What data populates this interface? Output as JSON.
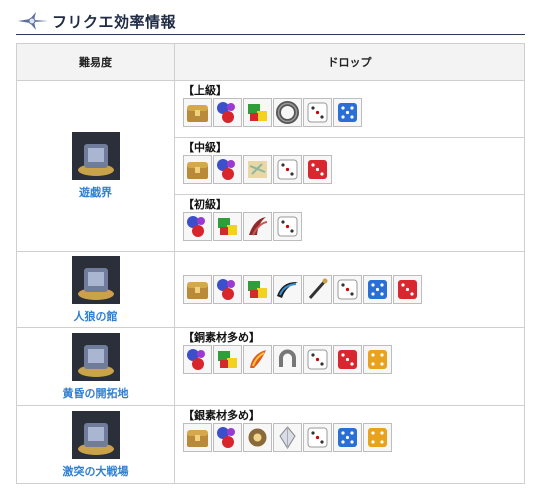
{
  "header": {
    "title": "フリクエ効率情報"
  },
  "table": {
    "col_area": "難易度",
    "col_drop": "ドロップ",
    "rows": [
      {
        "area": "遊戯界",
        "tiers": [
          {
            "label": "【上級】",
            "items": [
              "treasure-chest-icon",
              "gem-cluster-icon",
              "green-block-icon",
              "iron-ring-icon",
              "white-die-icon",
              "blue-die-icon"
            ]
          },
          {
            "label": "【中級】",
            "items": [
              "treasure-chest-icon",
              "gem-cluster-icon",
              "map-scroll-icon",
              "white-die-icon",
              "red-die-icon"
            ]
          },
          {
            "label": "【初級】",
            "items": [
              "gem-cluster-icon",
              "green-block-icon",
              "red-claw-icon",
              "white-die-icon"
            ]
          }
        ]
      },
      {
        "area": "人狼の館",
        "tiers": [
          {
            "label": "",
            "items": [
              "treasure-chest-icon",
              "gem-cluster-icon",
              "green-block-icon",
              "black-fang-icon",
              "wand-icon",
              "white-die-icon",
              "blue-die-icon",
              "red-die-icon"
            ]
          }
        ]
      },
      {
        "area": "黄昏の開拓地",
        "tiers": [
          {
            "label": "【銅素材多め】",
            "items": [
              "gem-cluster-icon",
              "green-block-icon",
              "flame-feather-icon",
              "horseshoe-icon",
              "white-die-icon",
              "red-die-icon",
              "gold-die-icon"
            ]
          }
        ]
      },
      {
        "area": "激突の大戦場",
        "tiers": [
          {
            "label": "【銀素材多め】",
            "items": [
              "treasure-chest-icon",
              "gem-cluster-icon",
              "bronze-orb-icon",
              "crystal-icon",
              "white-die-icon",
              "blue-die-icon",
              "gold-die-icon"
            ]
          }
        ]
      }
    ]
  },
  "colors": {
    "accent": "#2f7fd1",
    "title": "#1f2a44",
    "header_bg": "#f3f3f3",
    "border": "#cfcfcf"
  }
}
